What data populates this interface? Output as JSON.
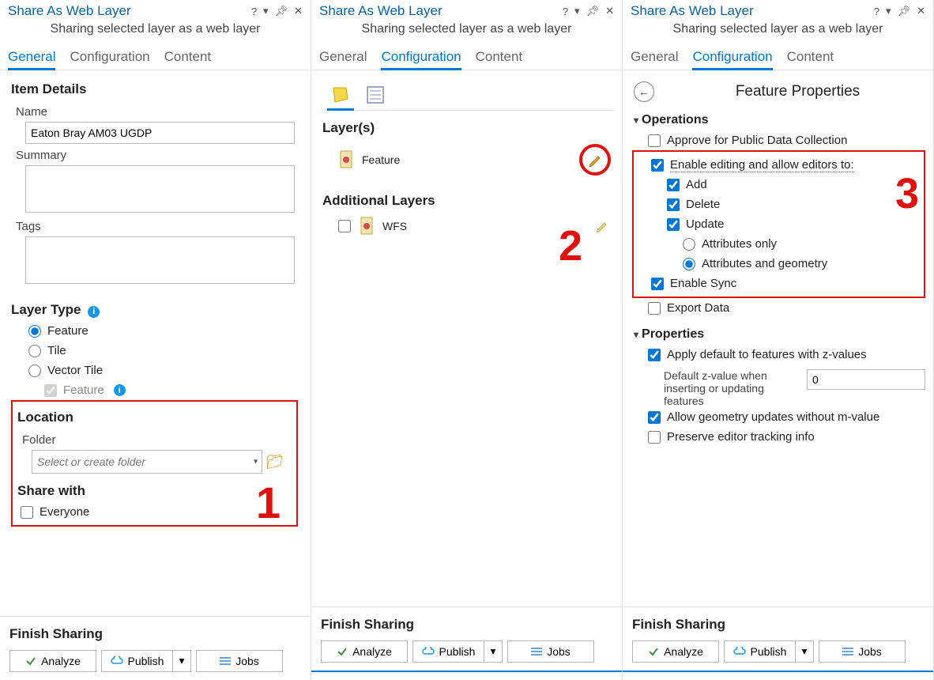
{
  "annotations": {
    "n1": "1",
    "n2": "2",
    "n3": "3"
  },
  "common": {
    "title": "Share As Web Layer",
    "subtitle": "Sharing selected layer as a web layer",
    "tabs": {
      "general": "General",
      "configuration": "Configuration",
      "content": "Content"
    },
    "tb": {
      "help": "?",
      "dropdown": "▾",
      "pin": "✱",
      "close": "✕"
    },
    "finish": "Finish Sharing",
    "buttons": {
      "analyze": "Analyze",
      "publish": "Publish",
      "jobs": "Jobs"
    }
  },
  "panel1": {
    "sections": {
      "itemDetails": "Item Details",
      "layerType": "Layer Type",
      "location": "Location",
      "shareWith": "Share with"
    },
    "labels": {
      "name": "Name",
      "summary": "Summary",
      "tags": "Tags",
      "folder": "Folder"
    },
    "values": {
      "name": "Eaton Bray AM03 UGDP",
      "summary": "",
      "tags": "",
      "folderPlaceholder": "Select or create folder"
    },
    "layerType": {
      "feature": "Feature",
      "tile": "Tile",
      "vectorTile": "Vector Tile",
      "vtFeature": "Feature"
    },
    "share": {
      "everyone": "Everyone"
    }
  },
  "panel2": {
    "layers_h": "Layer(s)",
    "feature": "Feature",
    "additional_h": "Additional Layers",
    "wfs": "WFS"
  },
  "panel3": {
    "fp_title": "Feature Properties",
    "ops": "Operations",
    "approve": "Approve for Public Data Collection",
    "enableEdit": "Enable editing and allow editors to:",
    "add": "Add",
    "delete": "Delete",
    "update": "Update",
    "attrOnly": "Attributes only",
    "attrGeo": "Attributes and geometry",
    "enableSync": "Enable Sync",
    "exportData": "Export Data",
    "props": "Properties",
    "applyZ": "Apply default to features with z-values",
    "defZ": "Default z-value when inserting or updating features",
    "zVal": "0",
    "allowM": "Allow geometry updates without m-value",
    "preserve": "Preserve editor tracking info"
  }
}
